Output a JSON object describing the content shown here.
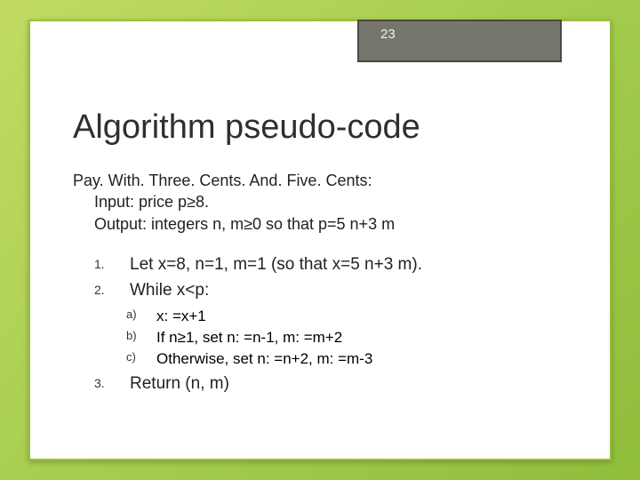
{
  "pageNumber": "23",
  "title": "Algorithm pseudo-code",
  "desc": {
    "line1": "Pay. With. Three. Cents. And. Five. Cents:",
    "line2": "Input: price p≥8.",
    "line3": "Output: integers n, m≥0 so that p=5 n+3 m"
  },
  "steps": {
    "s1": {
      "marker": "1.",
      "text": "Let x=8, n=1, m=1 (so that x=5 n+3 m)."
    },
    "s2": {
      "marker": "2.",
      "text": "While x<p:"
    },
    "sub": {
      "a": {
        "marker": "a)",
        "text": "x: =x+1"
      },
      "b": {
        "marker": "b)",
        "text": "If n≥1, set n: =n-1, m: =m+2"
      },
      "c": {
        "marker": "c)",
        "text": "Otherwise, set n: =n+2, m: =m-3"
      }
    },
    "s3": {
      "marker": "3.",
      "text": "Return (n, m)"
    }
  }
}
